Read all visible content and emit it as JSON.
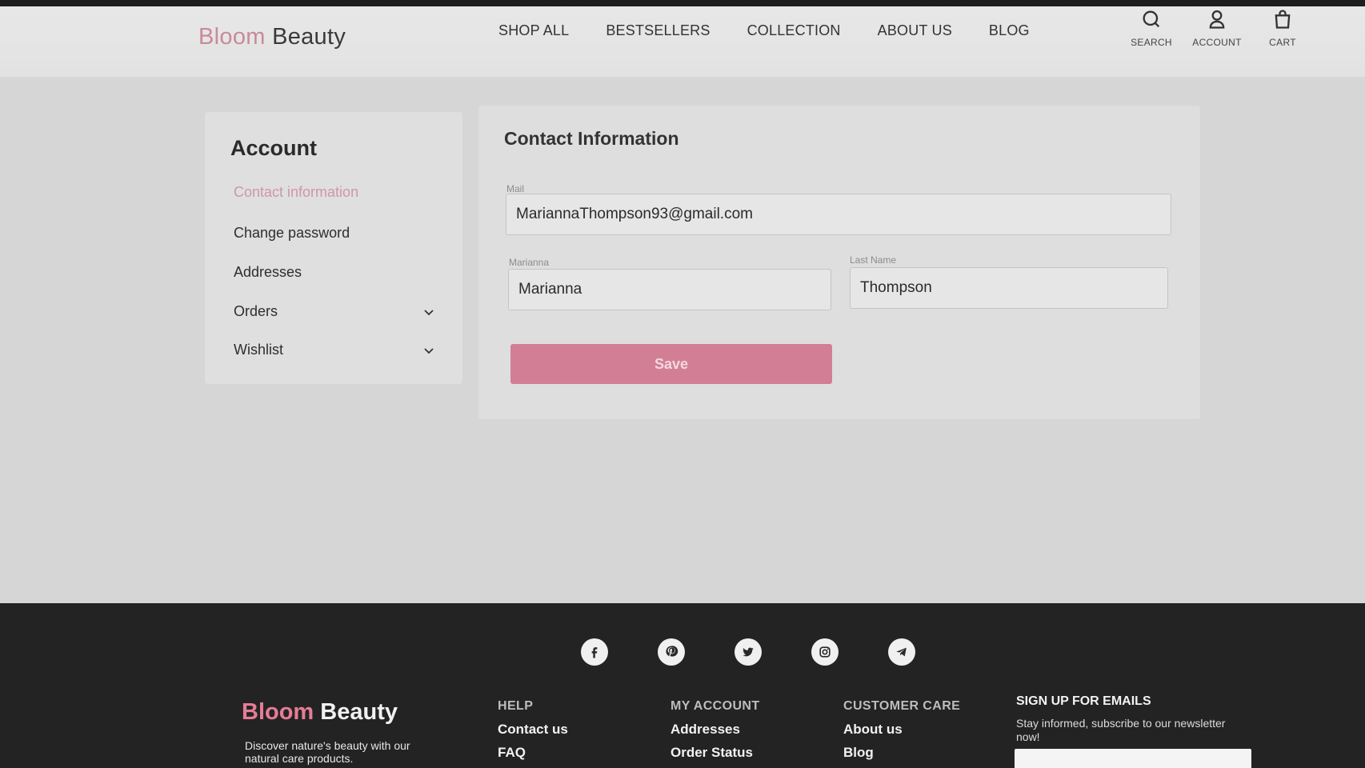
{
  "header": {
    "brand_first": "Bloom",
    "brand_second": "Beauty",
    "nav": [
      "SHOP ALL",
      "BESTSELLERS",
      "COLLECTION",
      "ABOUT US",
      "BLOG"
    ],
    "icons": [
      {
        "name": "search-icon",
        "label": "SEARCH"
      },
      {
        "name": "account-icon",
        "label": "ACCOUNT"
      },
      {
        "name": "cart-icon",
        "label": "CART"
      }
    ]
  },
  "sidebar": {
    "title": "Account",
    "items": [
      {
        "label": "Contact information",
        "active": true
      },
      {
        "label": "Change password"
      },
      {
        "label": "Addresses"
      },
      {
        "label": "Orders",
        "icon": "chevron-down-icon"
      },
      {
        "label": "Wishlist",
        "icon": "chevron-down-icon"
      }
    ]
  },
  "contact": {
    "title": "Contact Information",
    "mail_label": "Mail",
    "mail_value": "MariannaThompson93@gmail.com",
    "first_label": "Marianna",
    "first_value": "Marianna",
    "last_label": "Last Name",
    "last_value": "Thompson",
    "save_label": "Save"
  },
  "footer": {
    "social": [
      "facebook-icon",
      "pinterest-icon",
      "twitter-icon",
      "instagram-icon",
      "telegram-icon"
    ],
    "brand_first": "Bloom",
    "brand_second": "Beauty",
    "tagline": "Discover nature's beauty with our natural care products.",
    "columns": [
      {
        "title": "HELP",
        "links": [
          "Contact us",
          "FAQ"
        ]
      },
      {
        "title": "MY ACCOUNT",
        "links": [
          "Addresses",
          "Order Status"
        ]
      },
      {
        "title": "CUSTOMER CARE",
        "links": [
          "About us",
          "Blog"
        ]
      }
    ],
    "signup_title": "SIGN UP FOR EMAILS",
    "signup_text": "Stay informed, subscribe to our newsletter now!"
  },
  "colors": {
    "accent": "#d27f95",
    "brand_pink": "#c98a99",
    "footer_bg": "#232323"
  }
}
